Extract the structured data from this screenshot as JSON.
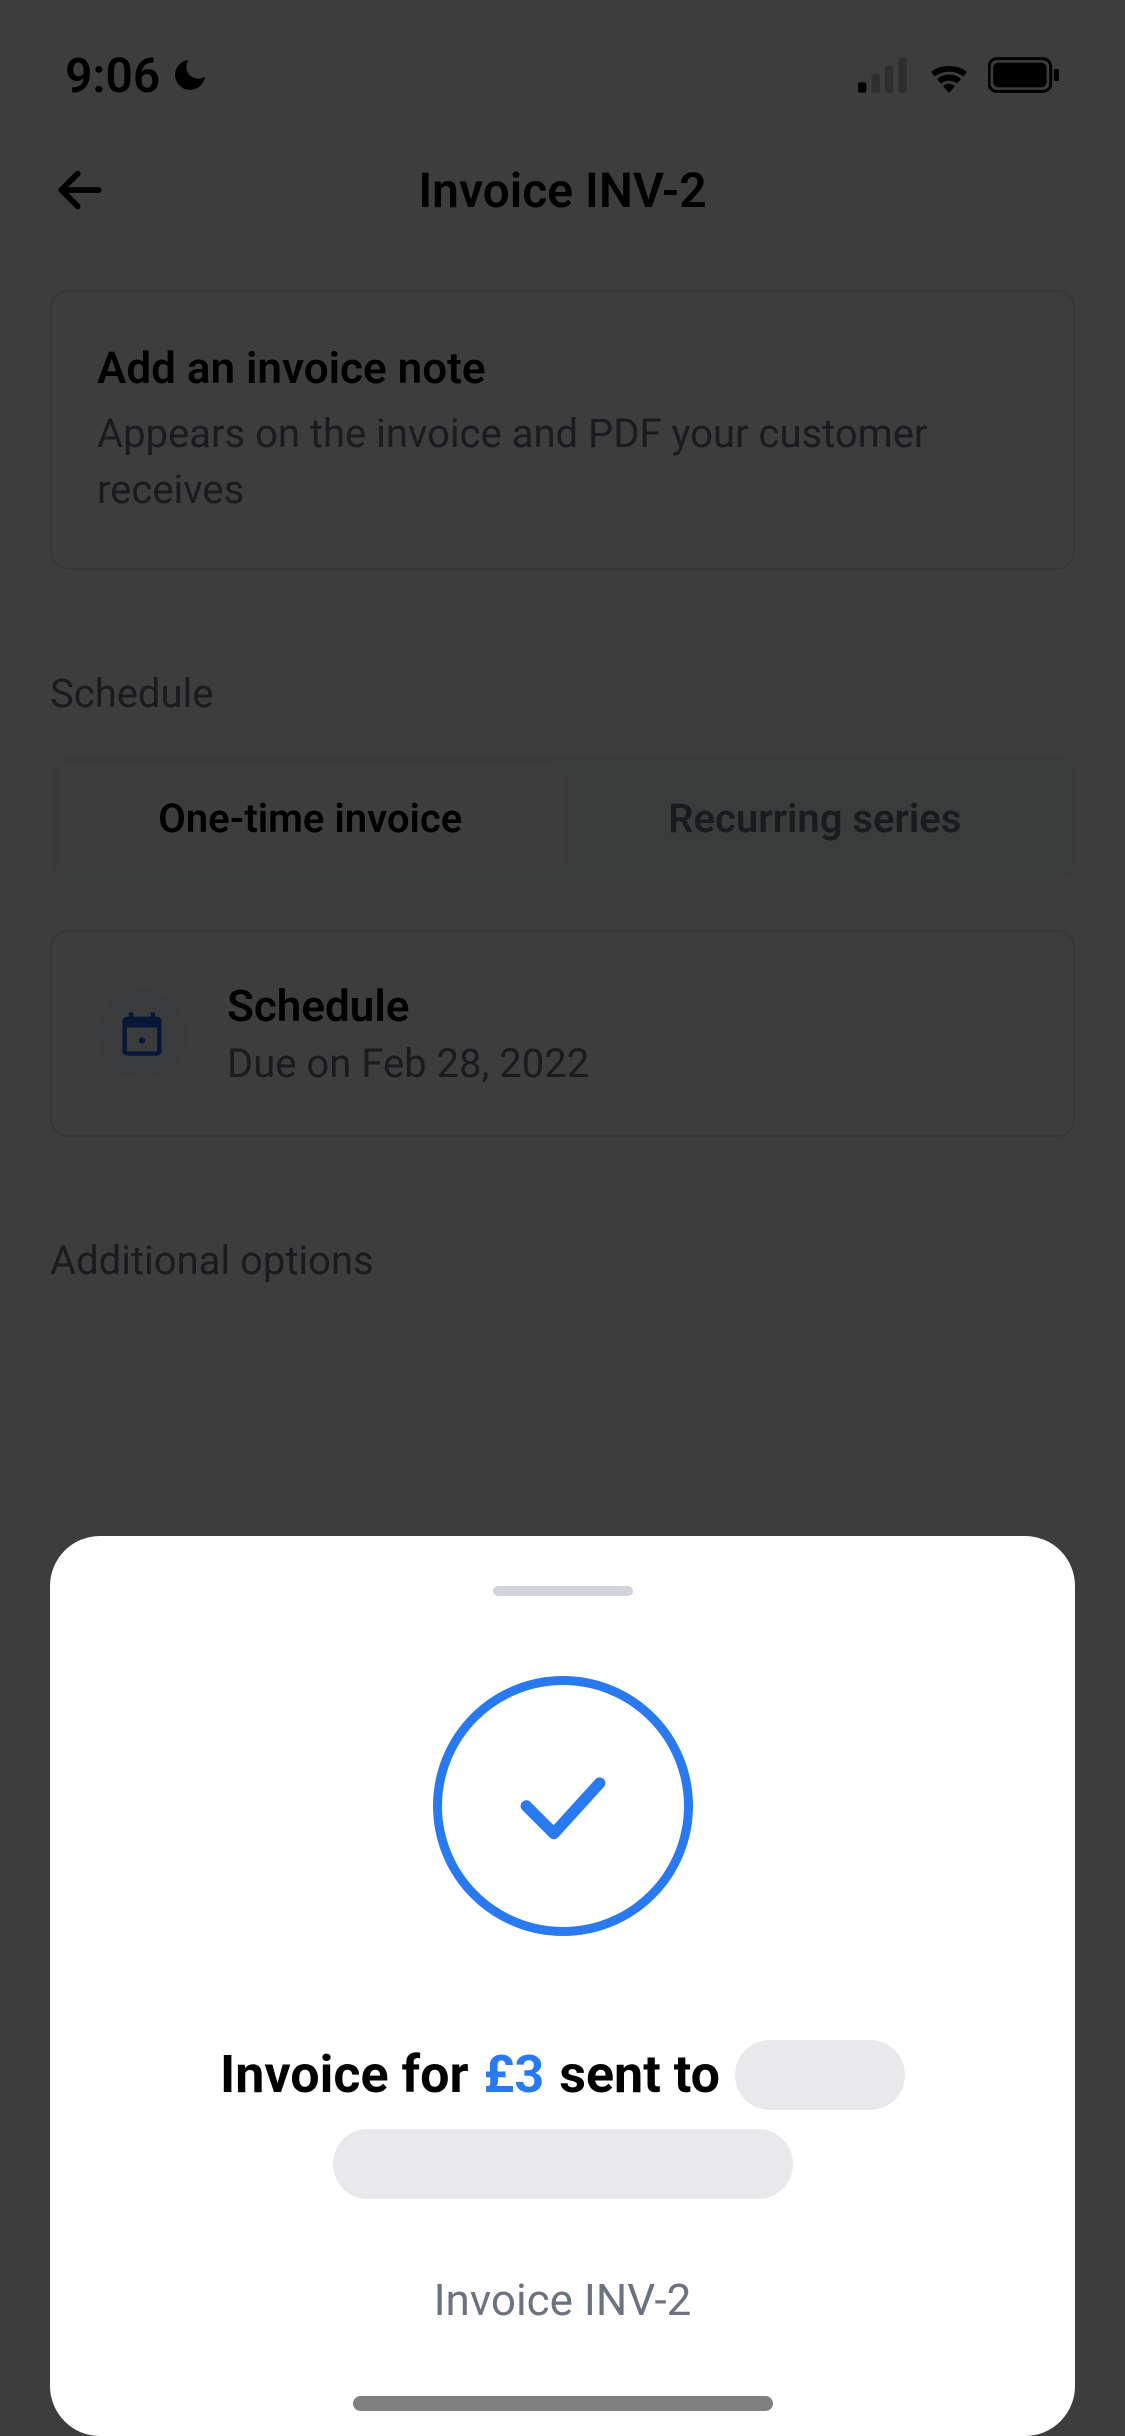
{
  "statusBar": {
    "time": "9:06"
  },
  "header": {
    "title": "Invoice INV-2"
  },
  "noteCard": {
    "title": "Add an invoice note",
    "subtitle": "Appears on the invoice and PDF your customer receives"
  },
  "schedule": {
    "sectionLabel": "Schedule",
    "tabs": {
      "oneTime": "One-time invoice",
      "recurring": "Recurring series"
    },
    "cardTitle": "Schedule",
    "cardSubtitle": "Due on Feb 28, 2022"
  },
  "additionalOptions": {
    "label": "Additional options"
  },
  "modal": {
    "titlePrefix": "Invoice for",
    "amount": "£3",
    "titleSuffix": "sent to",
    "subtitle": "Invoice INV-2"
  }
}
